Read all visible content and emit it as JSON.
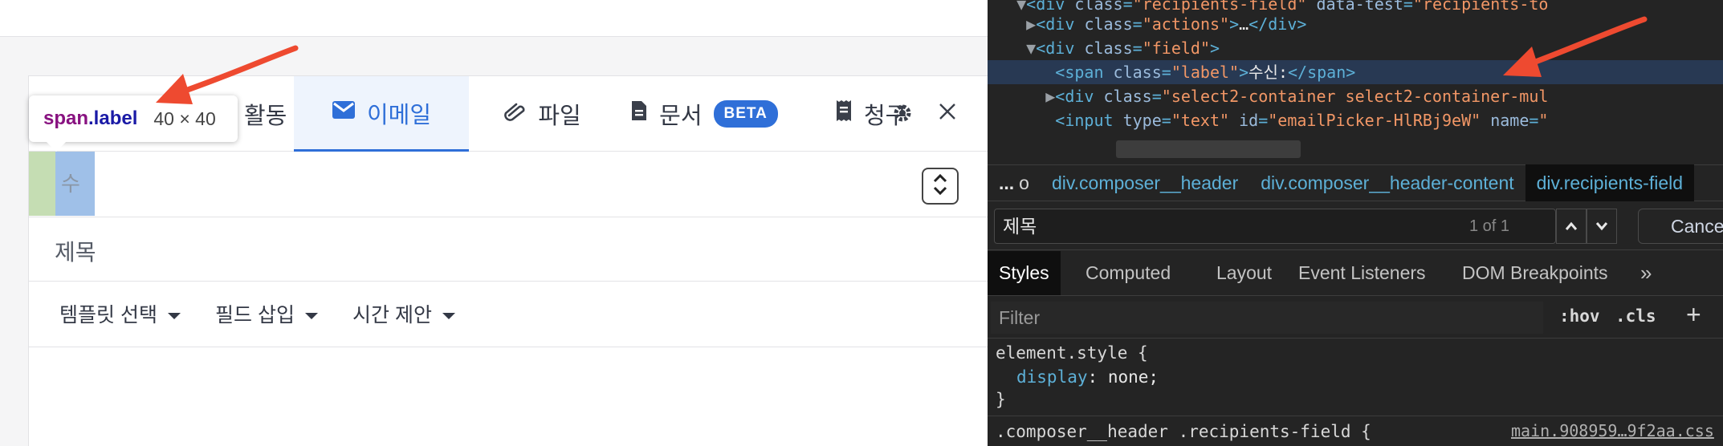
{
  "app": {
    "tabs": [
      {
        "label": "활동",
        "visible_fragment": "활동",
        "active": false
      },
      {
        "label": "이메일",
        "active": true
      },
      {
        "label": "파일",
        "active": false
      },
      {
        "label": "문서",
        "badge": "BETA",
        "active": false
      },
      {
        "label": "청구",
        "active": false
      }
    ],
    "recipients": {
      "label_fragment": "수"
    },
    "subject": {
      "label": "제목"
    },
    "toolbar": {
      "template_label": "템플릿 선택",
      "field_label": "필드 삽입",
      "time_label": "시간 제안"
    }
  },
  "inspect_tooltip": {
    "tag": "span",
    "class_name": ".label",
    "size": "40 × 40"
  },
  "devtools": {
    "elements": {
      "line1": {
        "attr1": "class",
        "val1": "\"recipients-field\"",
        "attr2": "data-test",
        "val2": "\"recipients-to"
      },
      "line2": {
        "attr": "class",
        "val": "\"actions\"",
        "ellipsis": "…"
      },
      "line3": {
        "attr": "class",
        "val": "\"field\""
      },
      "line4": {
        "attr": "class",
        "val": "\"label\"",
        "text": "수신:"
      },
      "line5": {
        "attr": "class",
        "val": "\"select2-container select2-container-mul"
      },
      "line6": {
        "attr1": "type",
        "val1": "\"text\"",
        "attr2": "id",
        "val2": "\"emailPicker-HlRBj9eW\"",
        "attr3": "name",
        "val3": "\""
      }
    },
    "breadcrumb": {
      "ellipsis": "...",
      "first": "o",
      "items": [
        {
          "tag": "div",
          "cls": ".composer__header"
        },
        {
          "tag": "div",
          "cls": ".composer__header-content"
        },
        {
          "tag": "div",
          "cls": ".recipients-field"
        }
      ]
    },
    "search": {
      "value": "제목",
      "count": "1 of 1",
      "cancel": "Cancel"
    },
    "panel_tabs": [
      "Styles",
      "Computed",
      "Layout",
      "Event Listeners",
      "DOM Breakpoints",
      "»"
    ],
    "filter": {
      "placeholder": "Filter",
      "hov": ":hov",
      "cls": ".cls",
      "plus": "+"
    },
    "styles": {
      "rule1_selector": "element.style {",
      "rule1_prop": "display",
      "rule1_value": "none;",
      "rule1_close": "}",
      "rule2_selector": ".composer__header .recipients-field {",
      "rule2_source": "main.908959…9f2aa.css"
    }
  },
  "colors": {
    "accent": "#2f6fd8",
    "arrow": "#ee4a30",
    "devtools_bg": "#242424",
    "selected_line": "#283953"
  },
  "icons": [
    "mail-icon",
    "paperclip-icon",
    "document-icon",
    "receipt-icon",
    "gear-icon",
    "close-icon",
    "updown-stepper-icon",
    "caret-down-icon",
    "caret-up-icon"
  ]
}
